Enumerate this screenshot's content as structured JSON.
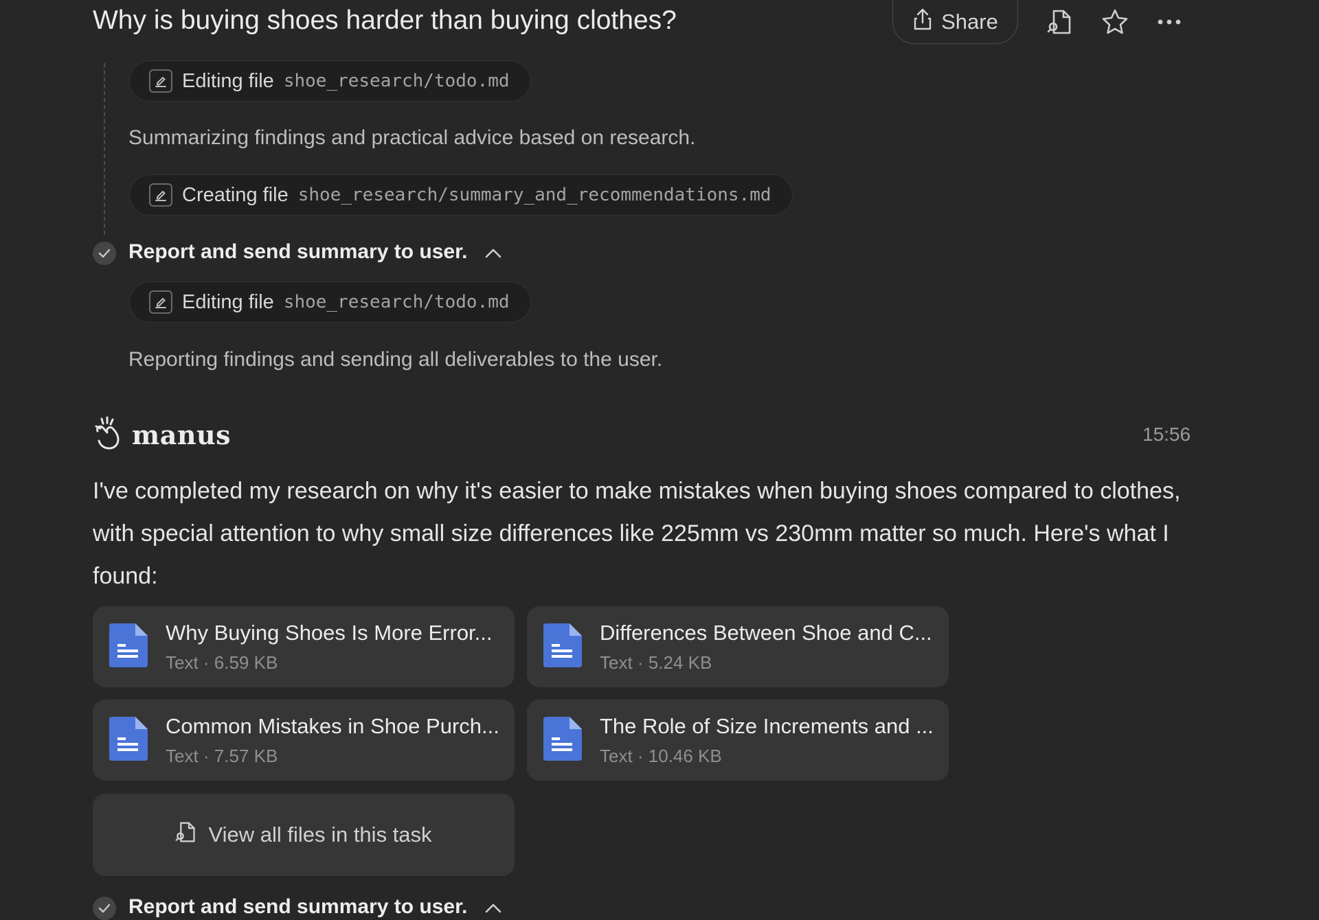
{
  "header": {
    "title": "Why is buying shoes harder than buying clothes?",
    "share_label": "Share",
    "icons": [
      "share-icon",
      "file-search-icon",
      "star-icon",
      "more-icon"
    ]
  },
  "steps": {
    "step1": {
      "edit_action": "Editing file",
      "edit_path": "shoe_research/todo.md",
      "note": "Summarizing findings and practical advice based on research.",
      "create_action": "Creating file",
      "create_path": "shoe_research/summary_and_recommendations.md"
    },
    "step2": {
      "title": "Report and send summary to user.",
      "edit_action": "Editing file",
      "edit_path": "shoe_research/todo.md",
      "note": "Reporting findings and sending all deliverables to the user."
    },
    "step3": {
      "title": "Report and send summary to user."
    }
  },
  "assistant": {
    "name": "manus",
    "time": "15:56",
    "message": "I've completed my research on why it's easier to make mistakes when buying shoes compared to clothes, with special attention to why small size differences like 225mm vs 230mm matter so much. Here's what I found:"
  },
  "files": [
    {
      "name": "Why Buying Shoes Is More Error...",
      "meta": "Text · 6.59 KB"
    },
    {
      "name": "Differences Between Shoe and C...",
      "meta": "Text · 5.24 KB"
    },
    {
      "name": "Common Mistakes in Shoe Purch...",
      "meta": "Text · 7.57 KB"
    },
    {
      "name": "The Role of Size Increments and ...",
      "meta": "Text · 10.46 KB"
    }
  ],
  "view_all_label": "View all files in this task",
  "colors": {
    "background": "#272727",
    "card": "#363636",
    "doc_icon": "#4a74d8"
  }
}
